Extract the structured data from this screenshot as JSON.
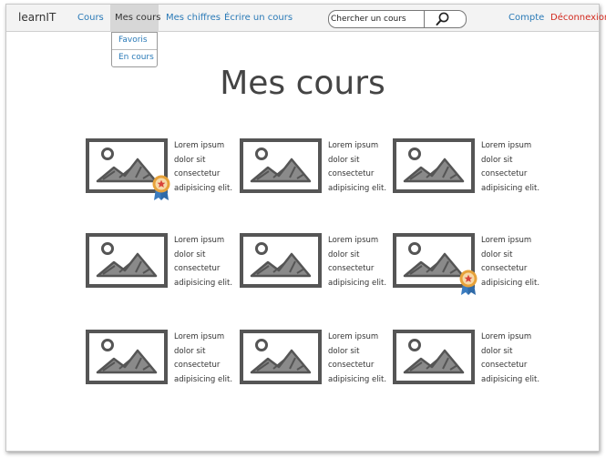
{
  "header": {
    "brand": "learnIT",
    "nav": {
      "cours": "Cours",
      "mes_cours": "Mes cours",
      "mes_chiffres": "Mes chiffres",
      "ecrire": "Écrire un cours"
    },
    "search": {
      "placeholder": "Chercher un cours"
    },
    "compte": "Compte",
    "deconnexion": "Déconnexion"
  },
  "dropdown": {
    "items": [
      "Favoris",
      "En cours"
    ]
  },
  "page_title": "Mes cours",
  "courses": [
    {
      "lines": [
        "Lorem ipsum",
        "dolor sit",
        "consectetur",
        "adipisicing elit."
      ],
      "badge": true
    },
    {
      "lines": [
        "Lorem ipsum",
        "dolor sit",
        "consectetur",
        "adipisicing elit."
      ],
      "badge": false
    },
    {
      "lines": [
        "Lorem ipsum",
        "dolor sit",
        "consectetur",
        "adipisicing elit."
      ],
      "badge": false
    },
    {
      "lines": [
        "Lorem ipsum",
        "dolor sit",
        "consectetur",
        "adipisicing elit."
      ],
      "badge": false
    },
    {
      "lines": [
        "Lorem ipsum",
        "dolor sit",
        "consectetur",
        "adipisicing elit."
      ],
      "badge": false
    },
    {
      "lines": [
        "Lorem ipsum",
        "dolor sit",
        "consectetur",
        "adipisicing elit."
      ],
      "badge": true
    },
    {
      "lines": [
        "Lorem ipsum",
        "dolor sit",
        "consectetur",
        "adipisicing elit."
      ],
      "badge": false
    },
    {
      "lines": [
        "Lorem ipsum",
        "dolor sit",
        "consectetur",
        "adipisicing elit."
      ],
      "badge": false
    },
    {
      "lines": [
        "Lorem ipsum",
        "dolor sit",
        "consectetur",
        "adipisicing elit."
      ],
      "badge": false
    }
  ],
  "colors": {
    "link": "#2a7ab7",
    "logout": "#d22a1f",
    "badge_ring": "#e7a23a",
    "ribbon": "#3a7bbf"
  },
  "icons": [
    "magnifier-icon",
    "image-placeholder-icon",
    "award-badge-icon"
  ]
}
